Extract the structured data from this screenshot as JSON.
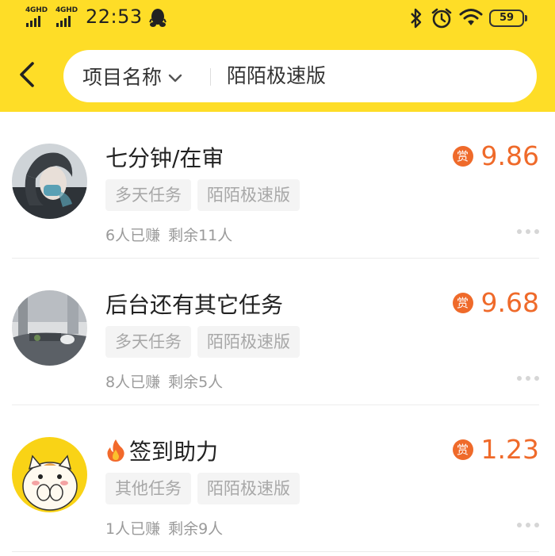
{
  "status_bar": {
    "network_1": "4GHD",
    "network_2": "4GHD",
    "time": "22:53",
    "battery": "59",
    "icons": [
      "qq-icon",
      "bluetooth-icon",
      "alarm-icon",
      "wifi-icon",
      "battery-icon"
    ]
  },
  "header": {
    "back_icon": "chevron-left-icon",
    "filter_label": "项目名称",
    "filter_icon": "chevron-down-icon",
    "search_value": "陌陌极速版"
  },
  "colors": {
    "header_bg": "#fedd27",
    "reward": "#ef6a2a",
    "tag_bg": "#f4f4f4",
    "tag_text": "#a8a8a8"
  },
  "tasks": [
    {
      "title": "七分钟/在审",
      "reward_badge": "赏",
      "reward": "9.86",
      "tags": [
        "多天任务",
        "陌陌极速版"
      ],
      "earned": "6人已赚",
      "remaining": "剩余11人"
    },
    {
      "title": "后台还有其它任务",
      "reward_badge": "赏",
      "reward": "9.68",
      "tags": [
        "多天任务",
        "陌陌极速版"
      ],
      "earned": "8人已赚",
      "remaining": "剩余5人"
    },
    {
      "title": "签到助力",
      "title_icon": "fire-icon",
      "reward_badge": "赏",
      "reward": "1.23",
      "tags": [
        "其他任务",
        "陌陌极速版"
      ],
      "earned": "1人已赚",
      "remaining": "剩余9人"
    }
  ]
}
